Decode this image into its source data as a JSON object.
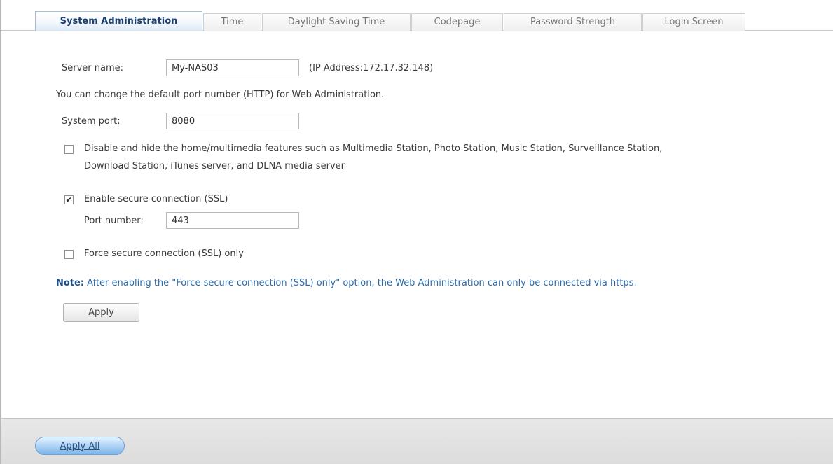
{
  "tabs": [
    {
      "label": "System Administration",
      "active": true
    },
    {
      "label": "Time",
      "active": false
    },
    {
      "label": "Daylight Saving Time",
      "active": false
    },
    {
      "label": "Codepage",
      "active": false
    },
    {
      "label": "Password Strength",
      "active": false
    },
    {
      "label": "Login Screen",
      "active": false
    }
  ],
  "server_name": {
    "label": "Server name:",
    "value": "My-NAS03",
    "ip_text": "(IP Address:172.17.32.148)"
  },
  "port_info": "You can change the default port number (HTTP) for Web Administration.",
  "system_port": {
    "label": "System port:",
    "value": "8080"
  },
  "disable_features": {
    "checked": false,
    "line1": "Disable and hide the home/multimedia features such as Multimedia Station, Photo Station, Music Station, Surveillance Station,",
    "line2": "Download Station, iTunes server, and DLNA media server"
  },
  "ssl": {
    "checked": true,
    "check_mark": "✔",
    "label": "Enable secure connection (SSL)",
    "port_label": "Port number:",
    "port_value": "443"
  },
  "force_ssl": {
    "checked": false,
    "label": "Force secure connection (SSL) only"
  },
  "note": {
    "prefix": "Note:",
    "text": " After enabling the \"Force secure connection (SSL) only\" option, the Web Administration can only be connected via https."
  },
  "buttons": {
    "apply": "Apply",
    "apply_all": "Apply All"
  },
  "colors": {
    "accent": "#1c3f6e",
    "note": "#2c6aa8",
    "apply_all": "#a9d0f5"
  }
}
